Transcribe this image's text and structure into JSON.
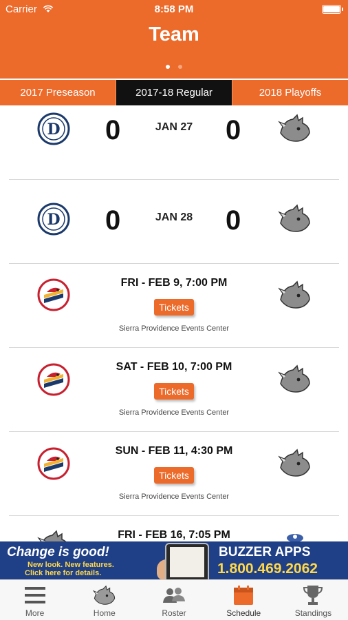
{
  "status_bar": {
    "carrier": "Carrier",
    "time": "8:58 PM"
  },
  "header": {
    "title": "Team",
    "page_count": 2,
    "active_page": 1
  },
  "season_tabs": [
    {
      "label": "2017 Preseason",
      "active": false
    },
    {
      "label": "2017-18 Regular",
      "active": true
    },
    {
      "label": "2018 Playoffs",
      "active": false
    }
  ],
  "games": [
    {
      "home_score": "0",
      "date": "JAN 27",
      "away_score": "0",
      "home_logo": "detroit-logo-icon",
      "away_logo": "rhino-logo-icon"
    },
    {
      "home_score": "0",
      "date": "JAN 28",
      "away_score": "0",
      "home_logo": "detroit-logo-icon",
      "away_logo": "rhino-logo-icon"
    },
    {
      "datetime": "FRI - FEB 9, 7:00 PM",
      "tickets_label": "Tickets",
      "venue": "Sierra Providence Events Center",
      "home_logo": "eagle-logo-icon",
      "away_logo": "rhino-logo-icon"
    },
    {
      "datetime": "SAT - FEB 10, 7:00 PM",
      "tickets_label": "Tickets",
      "venue": "Sierra Providence Events Center",
      "home_logo": "eagle-logo-icon",
      "away_logo": "rhino-logo-icon"
    },
    {
      "datetime": "SUN - FEB 11, 4:30 PM",
      "tickets_label": "Tickets",
      "venue": "Sierra Providence Events Center",
      "home_logo": "eagle-logo-icon",
      "away_logo": "rhino-logo-icon"
    },
    {
      "datetime": "FRI - FEB 16, 7:05 PM",
      "home_logo": "rhino-logo-icon",
      "away_logo": "team-logo-icon"
    }
  ],
  "ad": {
    "headline": "Change is good!",
    "subline1": "New look. New features.",
    "subline2": "Click here for details.",
    "brand": "BUZZER APPS",
    "phone": "1.800.469.2062"
  },
  "tabbar": [
    {
      "label": "More",
      "icon": "menu-icon",
      "active": false
    },
    {
      "label": "Home",
      "icon": "rhino-home-icon",
      "active": false
    },
    {
      "label": "Roster",
      "icon": "people-icon",
      "active": false
    },
    {
      "label": "Schedule",
      "icon": "calendar-icon",
      "active": true
    },
    {
      "label": "Standings",
      "icon": "trophy-icon",
      "active": false
    }
  ],
  "colors": {
    "brand_orange": "#ec6a2a",
    "active_tab": "#111111",
    "ad_blue": "#1f3f86",
    "ad_yellow": "#ffd84a"
  }
}
